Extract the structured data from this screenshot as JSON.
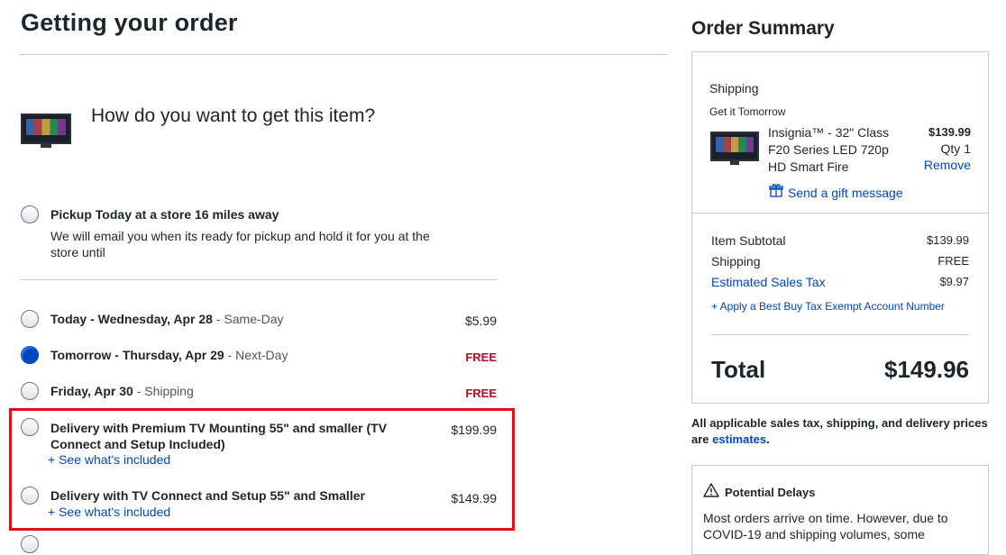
{
  "page": {
    "title": "Getting your order",
    "question": "How do you want to get this item?"
  },
  "pickup": {
    "title": "Pickup Today at a store 16 miles away",
    "desc": "We will email you when its ready for pickup and hold it for you at the store until"
  },
  "delivery_options": [
    {
      "title": "Today - Wednesday, Apr 28",
      "sub": " - Same-Day",
      "price": "$5.99",
      "selected": false
    },
    {
      "title": "Tomorrow - Thursday, Apr 29",
      "sub": " - Next-Day",
      "price": "FREE",
      "selected": true
    },
    {
      "title": "Friday, Apr 30",
      "sub": " - Shipping",
      "price": "FREE",
      "selected": false
    }
  ],
  "install_options": [
    {
      "title": "Delivery with Premium TV Mounting 55\" and smaller (TV Connect and Setup Included)",
      "price": "$199.99",
      "link": "+ See what's included"
    },
    {
      "title": "Delivery with TV Connect and Setup 55\" and Smaller",
      "price": "$149.99",
      "link": "+ See what's included"
    }
  ],
  "summary": {
    "title": "Order Summary",
    "section": "Shipping",
    "get_it": "Get it Tomorrow",
    "item_name": "Insignia™ - 32\" Class F20 Series LED 720p HD Smart Fire",
    "item_price": "$139.99",
    "item_qty": "Qty 1",
    "remove": "Remove",
    "gift": "Send a gift message",
    "subtotal_label": "Item Subtotal",
    "subtotal_value": "$139.99",
    "shipping_label": "Shipping",
    "shipping_value": "FREE",
    "tax_label": "Estimated Sales Tax",
    "tax_value": "$9.97",
    "tax_exempt": "+ Apply a Best Buy Tax Exempt Account Number",
    "total_label": "Total",
    "total_value": "$149.96"
  },
  "note": {
    "text": "All applicable sales tax, shipping, and delivery prices are",
    "link": "estimates",
    "end": "."
  },
  "delays": {
    "title": "Potential Delays",
    "text": "Most orders arrive on time. However, due to COVID-19 and shipping volumes, some"
  },
  "colors": {
    "link": "#0046be",
    "free": "#bb0628",
    "highlight": "#e0111b"
  }
}
